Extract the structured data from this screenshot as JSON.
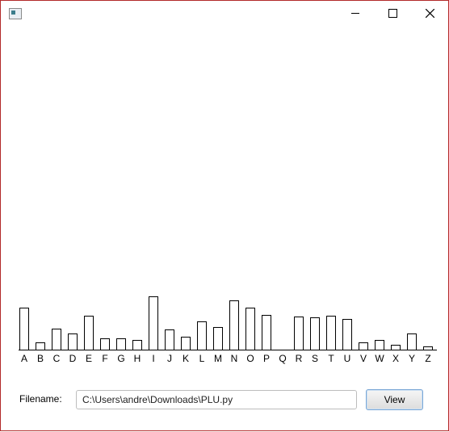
{
  "window": {
    "controls": {
      "minimize": "minimize-icon",
      "maximize": "maximize-icon",
      "close": "close-icon"
    }
  },
  "chart_data": {
    "type": "bar",
    "categories": [
      "A",
      "B",
      "C",
      "D",
      "E",
      "F",
      "G",
      "H",
      "I",
      "J",
      "K",
      "L",
      "M",
      "N",
      "O",
      "P",
      "Q",
      "R",
      "S",
      "T",
      "U",
      "V",
      "W",
      "X",
      "Y",
      "Z"
    ],
    "values": [
      52,
      9,
      26,
      20,
      42,
      14,
      14,
      12,
      66,
      25,
      16,
      35,
      28,
      61,
      52,
      43,
      0,
      41,
      40,
      42,
      38,
      9,
      12,
      6,
      20,
      4
    ],
    "bar_fill": "#ffffff",
    "bar_stroke": "#000000"
  },
  "form": {
    "filename_label": "Filename:",
    "filename_value": "C:\\Users\\andre\\Downloads\\PLU.py",
    "view_label": "View"
  }
}
